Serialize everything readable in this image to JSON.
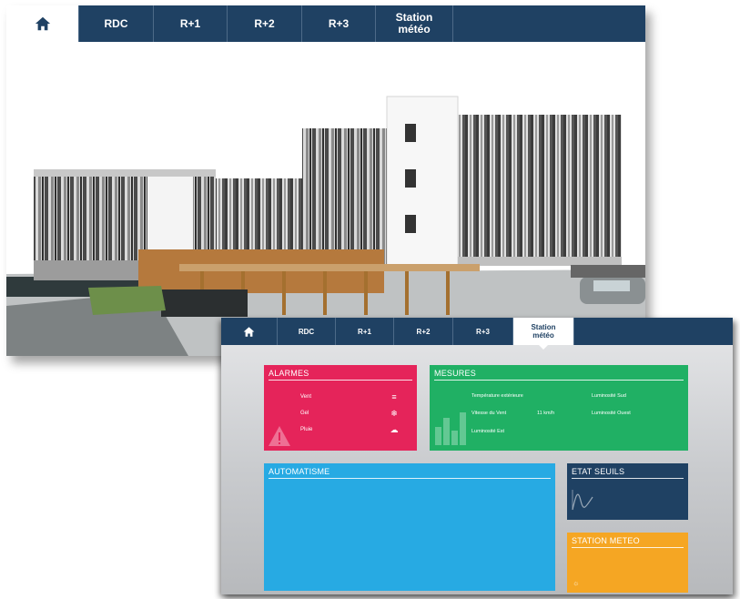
{
  "main_view": {
    "tabs": [
      {
        "label": "",
        "icon": "home-icon",
        "active": true
      },
      {
        "label": "RDC"
      },
      {
        "label": "R+1"
      },
      {
        "label": "R+2"
      },
      {
        "label": "R+3"
      },
      {
        "label": "Station\nmétéo"
      }
    ],
    "image_alt": "building-rendering"
  },
  "weather_view": {
    "tabs": [
      {
        "label": "",
        "icon": "home-icon"
      },
      {
        "label": "RDC"
      },
      {
        "label": "R+1"
      },
      {
        "label": "R+2"
      },
      {
        "label": "R+3"
      },
      {
        "label": "Station\nmétéo",
        "active": true
      }
    ],
    "alarmes": {
      "title": "ALARMES",
      "rows": [
        {
          "label": "Vent",
          "icon": "wind-icon",
          "glyph": "≡"
        },
        {
          "label": "Gel",
          "icon": "frost-icon",
          "glyph": "❄"
        },
        {
          "label": "Pluie",
          "icon": "rain-icon",
          "glyph": "☁"
        }
      ]
    },
    "mesures": {
      "title": "MESURES",
      "items": [
        {
          "label": "Température extérieure"
        },
        {
          "label": "Luminosité Sud"
        },
        {
          "label": "Vitesse du Vent",
          "value": "11 km/h"
        },
        {
          "label": "Luminosité Ouest"
        },
        {
          "label": "Luminosité Est"
        }
      ]
    },
    "automatisme": {
      "title": "AUTOMATISME"
    },
    "etat_seuils": {
      "title": "ETAT SEUILS"
    },
    "station_meteo": {
      "title": "STATION METEO"
    }
  },
  "colors": {
    "nav": "#1f4163",
    "alarmes": "#e5245a",
    "mesures": "#20b064",
    "automatisme": "#27aae3",
    "etat_seuils": "#1f4163",
    "station_meteo": "#f5a623"
  }
}
